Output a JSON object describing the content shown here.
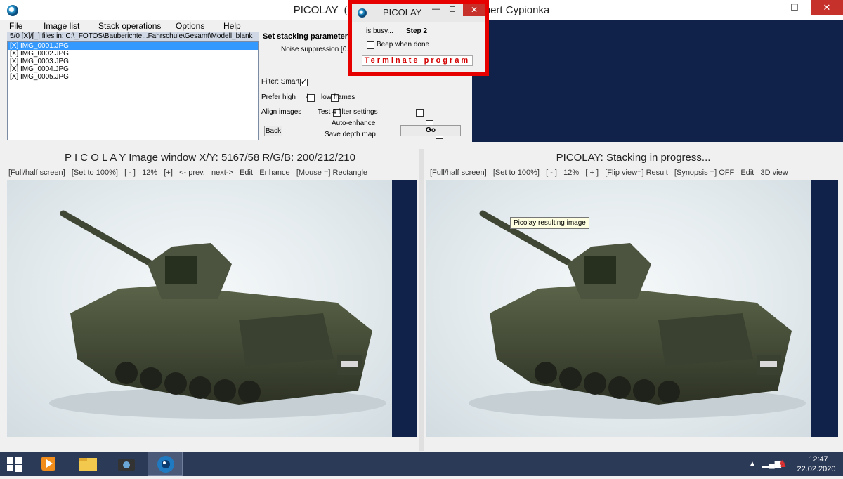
{
  "window": {
    "title": "PICOLAY  (64 b                                       ibert Cypionka",
    "minimize_glyph": "—",
    "maximize_glyph": "☐",
    "close_glyph": "✕",
    "icon": "picolay-app-icon"
  },
  "menubar": {
    "items": [
      "File",
      "Image list",
      "Stack operations",
      "Options",
      "Help"
    ]
  },
  "file_panel": {
    "header": "5/0 [X]/[_] files in: C:\\_FOTOS\\Bauberichte...Fahrschule\\Gesamt\\Modell_blank",
    "files": [
      {
        "label": "[X] IMG_0001.JPG",
        "selected": true
      },
      {
        "label": "[X] IMG_0002.JPG",
        "selected": false
      },
      {
        "label": "[X] IMG_0003.JPG",
        "selected": false
      },
      {
        "label": "[X] IMG_0004.JPG",
        "selected": false
      },
      {
        "label": "[X] IMG_0005.JPG",
        "selected": false
      }
    ]
  },
  "params": {
    "heading": "Set stacking parameters",
    "noise_suppression": "Noise suppression [0...",
    "filter_label": "Filter: Smart",
    "filter_checked": true,
    "prefer_high": "Prefer high",
    "slash": "/",
    "low_frames": "low frames",
    "align_images": "Align images",
    "test4": "Test 4 filter settings",
    "auto_enhance": "Auto-enhance",
    "save_depth": "Save depth map",
    "back_button": "Back",
    "go_button": "Go"
  },
  "dialog": {
    "title": "PICOLAY",
    "minimize_glyph": "—",
    "maximize_glyph": "☐",
    "close_glyph": "✕",
    "busy": "is busy...",
    "step": "Step 2",
    "beep": "Beep when done",
    "terminate": "Terminate program",
    "highlight_color": "#e60000"
  },
  "left_pane": {
    "title": "P I C O L A Y  Image window X/Y: 5167/58 R/G/B: 200/212/210",
    "toolbar": [
      "[Full/half screen]",
      "[Set to 100%]",
      "[ - ]",
      "12%",
      "[+]",
      "<- prev.",
      "next->",
      "Edit",
      "Enhance",
      "[Mouse =] Rectangle"
    ]
  },
  "right_pane": {
    "title": "PICOLAY: Stacking in progress...",
    "toolbar": [
      "[Full/half screen]",
      "[Set to 100%]",
      "[ - ]",
      "12%",
      "[ + ]",
      "[Flip view=] Result",
      "[Synopsis =] OFF",
      "Edit",
      "3D view"
    ],
    "tooltip": "Picolay resulting image"
  },
  "taskbar": {
    "items": [
      "start-button",
      "media-player-icon",
      "file-explorer-icon",
      "camera-app-icon",
      "picolay-app-icon"
    ],
    "time": "12:47",
    "date": "22.02.2020"
  },
  "colors": {
    "navy_background": "#10214a",
    "selection_blue": "#3399ff",
    "close_red": "#c7312c",
    "terminate_text": "#d40000"
  }
}
